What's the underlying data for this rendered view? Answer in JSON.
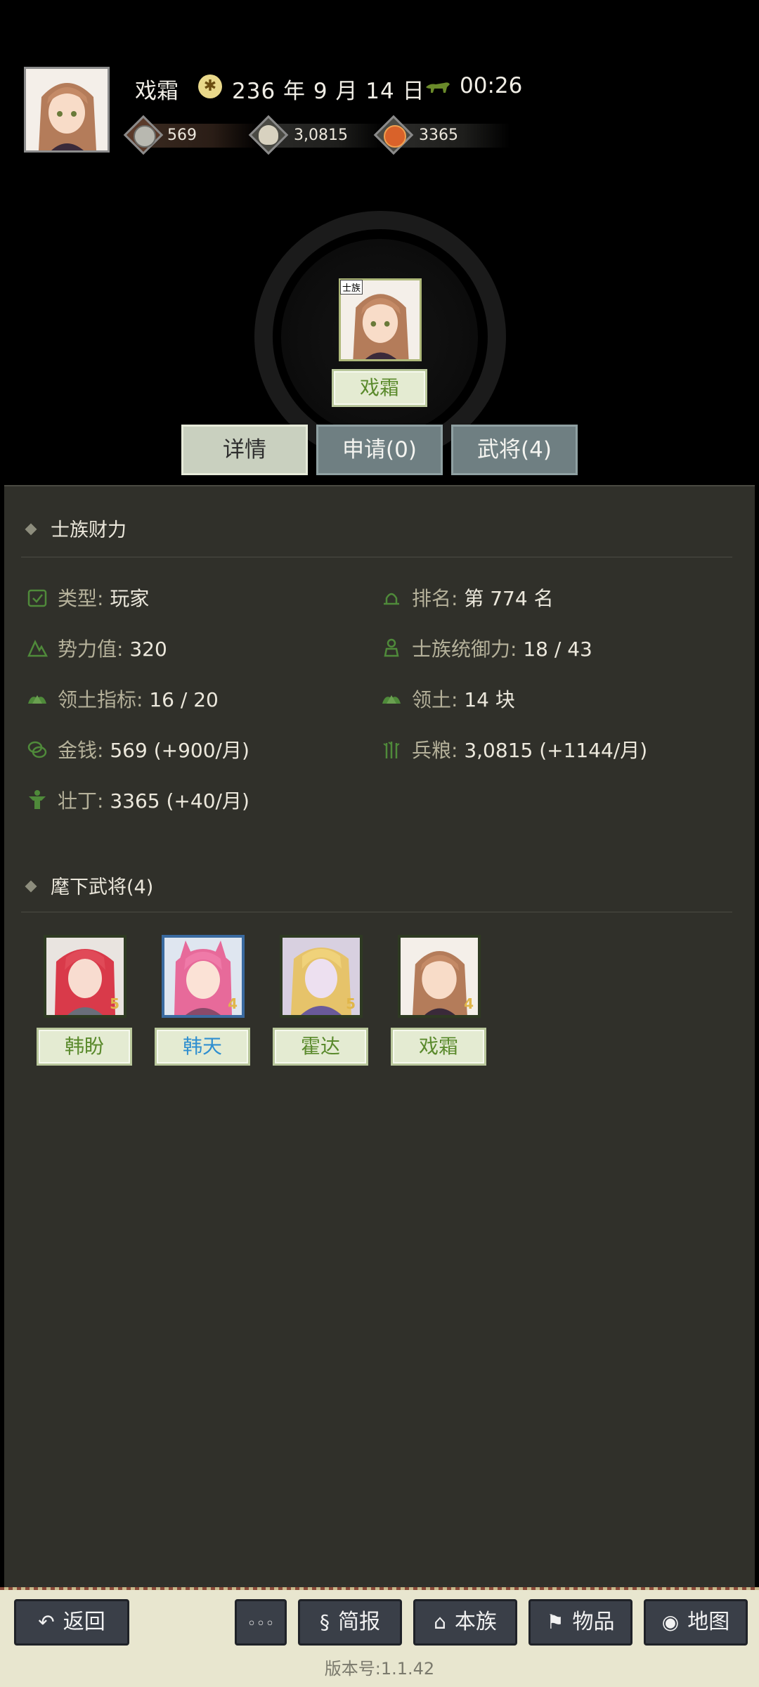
{
  "header": {
    "player_name": "戏霜",
    "date": "236 年 9 月 14 日",
    "time": "00:26",
    "resources": [
      {
        "icon": "silver-coin-icon",
        "value": "569"
      },
      {
        "icon": "grain-bowl-icon",
        "value": "3,0815"
      },
      {
        "icon": "manpower-icon",
        "value": "3365"
      }
    ]
  },
  "clan": {
    "tag": "士族",
    "name": "戏霜",
    "tabs": [
      "详情",
      "申请(0)",
      "武将(4)"
    ]
  },
  "section1": {
    "title": "士族财力",
    "stats": [
      {
        "icon": "type-icon",
        "label": "类型:",
        "value": "玩家"
      },
      {
        "icon": "rank-icon",
        "label": "排名:",
        "value": "第 774 名"
      },
      {
        "icon": "power-icon",
        "label": "势力值:",
        "value": "320"
      },
      {
        "icon": "command-icon",
        "label": "士族统御力:",
        "value": "18 / 43"
      },
      {
        "icon": "territory-quota-icon",
        "label": "领土指标:",
        "value": "16 / 20"
      },
      {
        "icon": "territory-icon",
        "label": "领土:",
        "value": "14 块"
      },
      {
        "icon": "money-icon",
        "label": "金钱:",
        "value": "569 (+900/月)"
      },
      {
        "icon": "provisions-icon",
        "label": "兵粮:",
        "value": "3,0815 (+1144/月)"
      },
      {
        "icon": "strongman-icon",
        "label": "壮丁:",
        "value": "3365 (+40/月)"
      }
    ]
  },
  "section2": {
    "title": "麾下武将(4)",
    "generals": [
      {
        "name": "韩盼",
        "cost": "5",
        "name_color": "#5a8a2c"
      },
      {
        "name": "韩天",
        "cost": "4",
        "name_color": "#2f8fd0"
      },
      {
        "name": "霍达",
        "cost": "5",
        "name_color": "#5a8a2c"
      },
      {
        "name": "戏霜",
        "cost": "4",
        "name_color": "#5a8a2c"
      }
    ]
  },
  "nav": {
    "back": "返回",
    "more": "◦◦◦",
    "briefing": "简报",
    "clan": "本族",
    "items": "物品",
    "map": "地图"
  },
  "version": "版本号:1.1.42"
}
